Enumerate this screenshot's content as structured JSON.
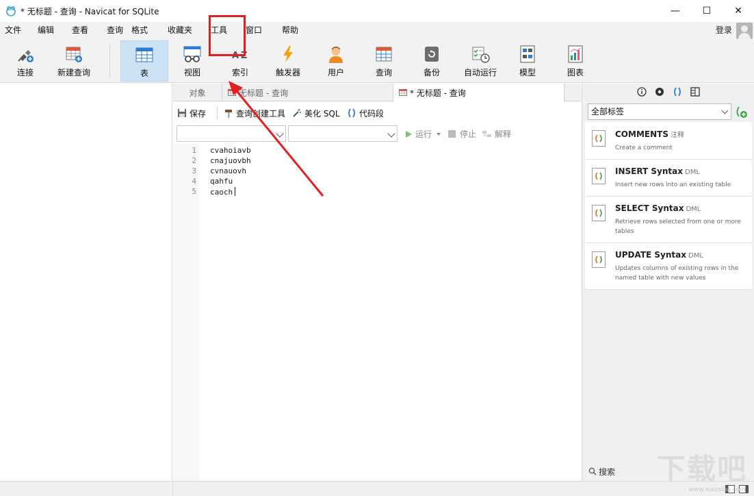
{
  "window": {
    "title": "* 无标题 - 查询 - Navicat for SQLite",
    "minimize": "—",
    "maximize": "☐",
    "close": "✕"
  },
  "menu": {
    "items": [
      "文件",
      "编辑",
      "查看",
      "查询",
      "格式",
      "收藏夹",
      "工具",
      "窗口",
      "帮助"
    ],
    "login": "登录"
  },
  "toolbar": {
    "items": [
      {
        "label": "连接",
        "icon": "connection-icon"
      },
      {
        "label": "新建查询",
        "icon": "new-query-icon"
      },
      {
        "label": "表",
        "icon": "table-icon"
      },
      {
        "label": "视图",
        "icon": "view-icon"
      },
      {
        "label": "索引",
        "icon": "index-icon"
      },
      {
        "label": "触发器",
        "icon": "trigger-icon"
      },
      {
        "label": "用户",
        "icon": "user-icon"
      },
      {
        "label": "查询",
        "icon": "query-icon"
      },
      {
        "label": "备份",
        "icon": "backup-icon"
      },
      {
        "label": "自动运行",
        "icon": "automation-icon"
      },
      {
        "label": "模型",
        "icon": "model-icon"
      },
      {
        "label": "图表",
        "icon": "chart-icon"
      }
    ]
  },
  "tabs": {
    "objects": "对象",
    "tab1": "无标题 - 查询",
    "tab2": "* 无标题 - 查询"
  },
  "editor_toolbar": {
    "save": "保存",
    "query_builder": "查询创建工具",
    "beautify": "美化 SQL",
    "snippet": "代码段",
    "run": "运行",
    "stop": "停止",
    "explain": "解释"
  },
  "code": {
    "line_numbers": [
      "1",
      "2",
      "3",
      "4",
      "5"
    ],
    "lines": [
      "cvahoiavb",
      "cnajuovbh",
      "cvnauovh",
      "qahfu",
      "caoch"
    ]
  },
  "snippets": {
    "filter": "全部标签",
    "items": [
      {
        "title": "COMMENTS",
        "type": "注释",
        "desc": "Create a comment"
      },
      {
        "title": "INSERT Syntax",
        "type": "DML",
        "desc": "Insert new rows into an existing table"
      },
      {
        "title": "SELECT Syntax",
        "type": "DML",
        "desc": "Retrieve rows selected from one or more tables"
      },
      {
        "title": "UPDATE Syntax",
        "type": "DML",
        "desc": "Updates columns of existing rows in the named table with new values"
      }
    ],
    "search_placeholder": "搜索"
  },
  "watermark": {
    "logo": "下载吧",
    "url": "www.xiazaiba.com"
  },
  "colors": {
    "annotation": "#e02020",
    "active_tool": "#cde3f5",
    "accent": "#2b7cd3"
  }
}
